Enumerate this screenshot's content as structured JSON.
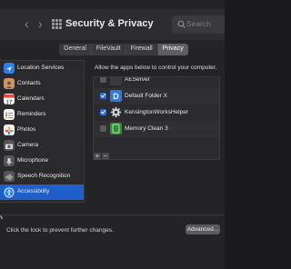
{
  "titlebar": {
    "back": "‹",
    "forward": "›",
    "title": "Security & Privacy",
    "search_placeholder": "Search"
  },
  "tabs": [
    {
      "label": "General"
    },
    {
      "label": "FileVault"
    },
    {
      "label": "Firewall"
    },
    {
      "label": "Privacy",
      "active": true
    }
  ],
  "sidebar": {
    "items": [
      {
        "label": "Location Services",
        "icon": "location-icon",
        "color": "#2a7ef0"
      },
      {
        "label": "Contacts",
        "icon": "contacts-icon",
        "color": "#c99566"
      },
      {
        "label": "Calendars",
        "icon": "calendar-icon",
        "color": "#f2f2f2"
      },
      {
        "label": "Reminders",
        "icon": "reminders-icon",
        "color": "#f2f2f2"
      },
      {
        "label": "Photos",
        "icon": "photos-icon",
        "color": "#f2f2f2"
      },
      {
        "label": "Camera",
        "icon": "camera-icon",
        "color": "#555558"
      },
      {
        "label": "Microphone",
        "icon": "microphone-icon",
        "color": "#555558"
      },
      {
        "label": "Speech Recognition",
        "icon": "speech-recognition-icon",
        "color": "#555558"
      },
      {
        "label": "Accessibility",
        "icon": "accessibility-icon",
        "color": "#2a7ef0",
        "selected": true
      }
    ]
  },
  "main": {
    "instruction": "Allow the apps below to control your computer.",
    "apps": [
      {
        "label": "AEServer",
        "checked": false,
        "icon": "aeserver-icon"
      },
      {
        "label": "Default Folder X",
        "checked": true,
        "icon": "default-folder-x-icon"
      },
      {
        "label": "KensingtonWorksHelper",
        "checked": true,
        "icon": "gear-icon"
      },
      {
        "label": "Memory Clean 3",
        "checked": false,
        "icon": "memory-clean-icon"
      }
    ],
    "add_label": "+",
    "remove_label": "−"
  },
  "footer": {
    "lock_text": "Click the lock to prevent further changes.",
    "advanced_label": "Advanced..."
  },
  "colors": {
    "accent": "#1f5fc9",
    "checkbox": "#2f6fe0"
  }
}
